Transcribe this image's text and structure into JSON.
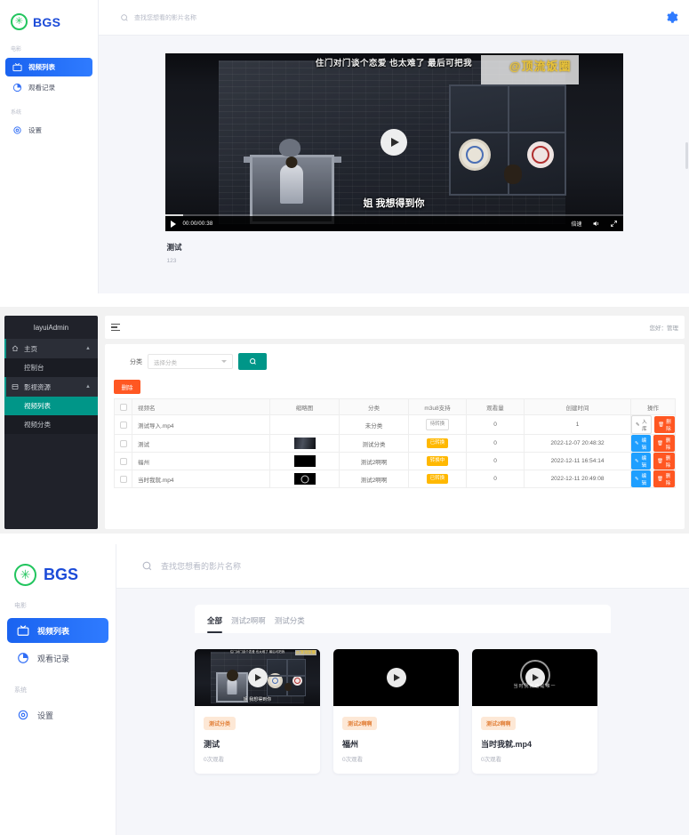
{
  "brand": {
    "name": "BGS",
    "logo_icon": "asterisk-badge-icon"
  },
  "player_page": {
    "sidebar": {
      "groups": [
        {
          "label": "电影",
          "items": [
            {
              "label": "视频列表",
              "icon": "tv-icon",
              "active": true
            },
            {
              "label": "观看记录",
              "icon": "history-pie-icon",
              "active": false
            }
          ]
        },
        {
          "label": "系统",
          "items": [
            {
              "label": "设置",
              "icon": "gear-icon",
              "active": false
            }
          ]
        }
      ]
    },
    "search": {
      "placeholder": "查找您想看的影片名称",
      "icon": "search-icon",
      "value": ""
    },
    "settings_icon": "gear-icon",
    "player": {
      "subtitle_top": "住门对门谈个恋爱 也太难了 最后可把我",
      "subtitle_bottom": "姐 我想得到你",
      "watermark": "@顶流饭圈",
      "time": "00:00/00:38",
      "speed_label": "倍速",
      "play_icon": "play-icon",
      "volume_icon": "volume-icon",
      "fullscreen_icon": "fullscreen-icon",
      "progress_percent": 4
    },
    "video": {
      "title": "测试",
      "description": "123"
    }
  },
  "admin_page": {
    "logo": "layuiAdmin",
    "user_greeting": "您好：管理",
    "menu": [
      {
        "label": "主页",
        "icon": "home-icon",
        "expanded": true,
        "children": [
          {
            "label": "控制台",
            "active": false
          }
        ]
      },
      {
        "label": "影视资源",
        "icon": "film-icon",
        "expanded": true,
        "children": [
          {
            "label": "视频列表",
            "active": true
          },
          {
            "label": "视频分类",
            "active": false
          }
        ]
      }
    ],
    "filter": {
      "label": "分类",
      "select_placeholder": "选择分类",
      "search_icon": "search-icon"
    },
    "delete_button": "删除",
    "table": {
      "columns": [
        "",
        "视频名",
        "缩略图",
        "分类",
        "m3u8支持",
        "观看量",
        "创建时间",
        "操作"
      ],
      "rows": [
        {
          "name": "测试导入.mp4",
          "thumb": "none",
          "category": "未分类",
          "m3u8": "待转换",
          "m3u8_state": "wait",
          "views": "0",
          "created": "1",
          "actions": [
            {
              "label": "入库",
              "type": "store",
              "icon": "pencil-icon"
            },
            {
              "label": "删除",
              "type": "del",
              "icon": "trash-icon"
            }
          ]
        },
        {
          "name": "测试",
          "thumb": "scene",
          "category": "测试分类",
          "m3u8": "已转换",
          "m3u8_state": "done",
          "views": "0",
          "created": "2022-12-07 20:48:32",
          "actions": [
            {
              "label": "编辑",
              "type": "edit",
              "icon": "pencil-icon"
            },
            {
              "label": "删除",
              "type": "del",
              "icon": "trash-icon"
            }
          ]
        },
        {
          "name": "福州",
          "thumb": "black",
          "category": "测试2啊啊",
          "m3u8": "转换中",
          "m3u8_state": "doing",
          "views": "0",
          "created": "2022-12-11 16:54:14",
          "actions": [
            {
              "label": "编辑",
              "type": "edit",
              "icon": "pencil-icon"
            },
            {
              "label": "删除",
              "type": "del",
              "icon": "trash-icon"
            }
          ]
        },
        {
          "name": "当时我就.mp4",
          "thumb": "disc",
          "category": "测试2啊啊",
          "m3u8": "已转换",
          "m3u8_state": "done",
          "views": "0",
          "created": "2022-12-11 20:49:08",
          "actions": [
            {
              "label": "编辑",
              "type": "edit",
              "icon": "pencil-icon"
            },
            {
              "label": "删除",
              "type": "del",
              "icon": "trash-icon"
            }
          ]
        }
      ]
    }
  },
  "list_page": {
    "sidebar": {
      "groups": [
        {
          "label": "电影",
          "items": [
            {
              "label": "视频列表",
              "icon": "tv-icon",
              "active": true
            },
            {
              "label": "观看记录",
              "icon": "history-pie-icon",
              "active": false
            }
          ]
        },
        {
          "label": "系统",
          "items": [
            {
              "label": "设置",
              "icon": "gear-icon",
              "active": false
            }
          ]
        }
      ]
    },
    "search": {
      "placeholder": "查找您想看的影片名称",
      "icon": "search-icon",
      "value": ""
    },
    "tabs": [
      {
        "label": "全部",
        "active": true
      },
      {
        "label": "测试2啊啊",
        "active": false
      },
      {
        "label": "测试分类",
        "active": false
      }
    ],
    "cards": [
      {
        "tag": "测试分类",
        "title": "测试",
        "views": "0次观看",
        "thumb": "scene",
        "sub_top": "住门对门谈个恋爱 也太难了 最后可把我",
        "sub_bottom": "姐 我想得到你",
        "watermark": "@顶流饭圈"
      },
      {
        "tag": "测试2啊啊",
        "title": "福州",
        "views": "0次观看",
        "thumb": "black"
      },
      {
        "tag": "测试2啊啊",
        "title": "当时我就.mp4",
        "views": "0次观看",
        "thumb": "disc",
        "art_text": "当时我就这是唯一"
      }
    ]
  },
  "colors": {
    "accent_blue": "#2f7bff",
    "brand_blue": "#1b4bd8",
    "logo_green": "#22c55e",
    "admin_teal": "#009688",
    "danger_orange": "#ff5722",
    "warn_yellow": "#ffb800",
    "tag_bg": "#fde8d6",
    "tag_text": "#e2813a"
  }
}
